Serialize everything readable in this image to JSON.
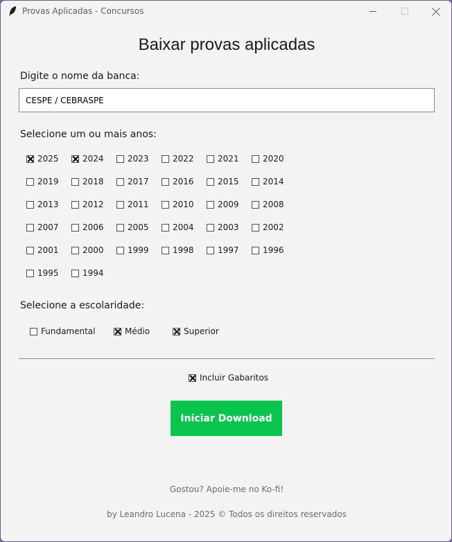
{
  "window": {
    "title": "Provas Aplicadas - Concursos",
    "icon": "feather-icon"
  },
  "heading": "Baixar provas aplicadas",
  "banca": {
    "label": "Digite o nome da banca:",
    "value": "CESPE / CEBRASPE"
  },
  "anos": {
    "label": "Selecione um ou mais anos:",
    "items": [
      {
        "label": "2025",
        "checked": true
      },
      {
        "label": "2024",
        "checked": true
      },
      {
        "label": "2023",
        "checked": false
      },
      {
        "label": "2022",
        "checked": false
      },
      {
        "label": "2021",
        "checked": false
      },
      {
        "label": "2020",
        "checked": false
      },
      {
        "label": "2019",
        "checked": false
      },
      {
        "label": "2018",
        "checked": false
      },
      {
        "label": "2017",
        "checked": false
      },
      {
        "label": "2016",
        "checked": false
      },
      {
        "label": "2015",
        "checked": false
      },
      {
        "label": "2014",
        "checked": false
      },
      {
        "label": "2013",
        "checked": false
      },
      {
        "label": "2012",
        "checked": false
      },
      {
        "label": "2011",
        "checked": false
      },
      {
        "label": "2010",
        "checked": false
      },
      {
        "label": "2009",
        "checked": false
      },
      {
        "label": "2008",
        "checked": false
      },
      {
        "label": "2007",
        "checked": false
      },
      {
        "label": "2006",
        "checked": false
      },
      {
        "label": "2005",
        "checked": false
      },
      {
        "label": "2004",
        "checked": false
      },
      {
        "label": "2003",
        "checked": false
      },
      {
        "label": "2002",
        "checked": false
      },
      {
        "label": "2001",
        "checked": false
      },
      {
        "label": "2000",
        "checked": false
      },
      {
        "label": "1999",
        "checked": false
      },
      {
        "label": "1998",
        "checked": false
      },
      {
        "label": "1997",
        "checked": false
      },
      {
        "label": "1996",
        "checked": false
      },
      {
        "label": "1995",
        "checked": false
      },
      {
        "label": "1994",
        "checked": false
      }
    ]
  },
  "escolaridade": {
    "label": "Selecione a escolaridade:",
    "items": [
      {
        "label": "Fundamental",
        "checked": false
      },
      {
        "label": "Médio",
        "checked": true
      },
      {
        "label": "Superior",
        "checked": true
      }
    ]
  },
  "gabaritos": {
    "label": "Incluir Gabaritos",
    "checked": true
  },
  "download_button": {
    "label": "Iniciar Download",
    "color": "#0bc44e"
  },
  "footer": {
    "kofi": "Gostou? Apoie-me no Ko-fi!",
    "credits": "by Leandro Lucena - 2025 © Todos os direitos reservados"
  }
}
